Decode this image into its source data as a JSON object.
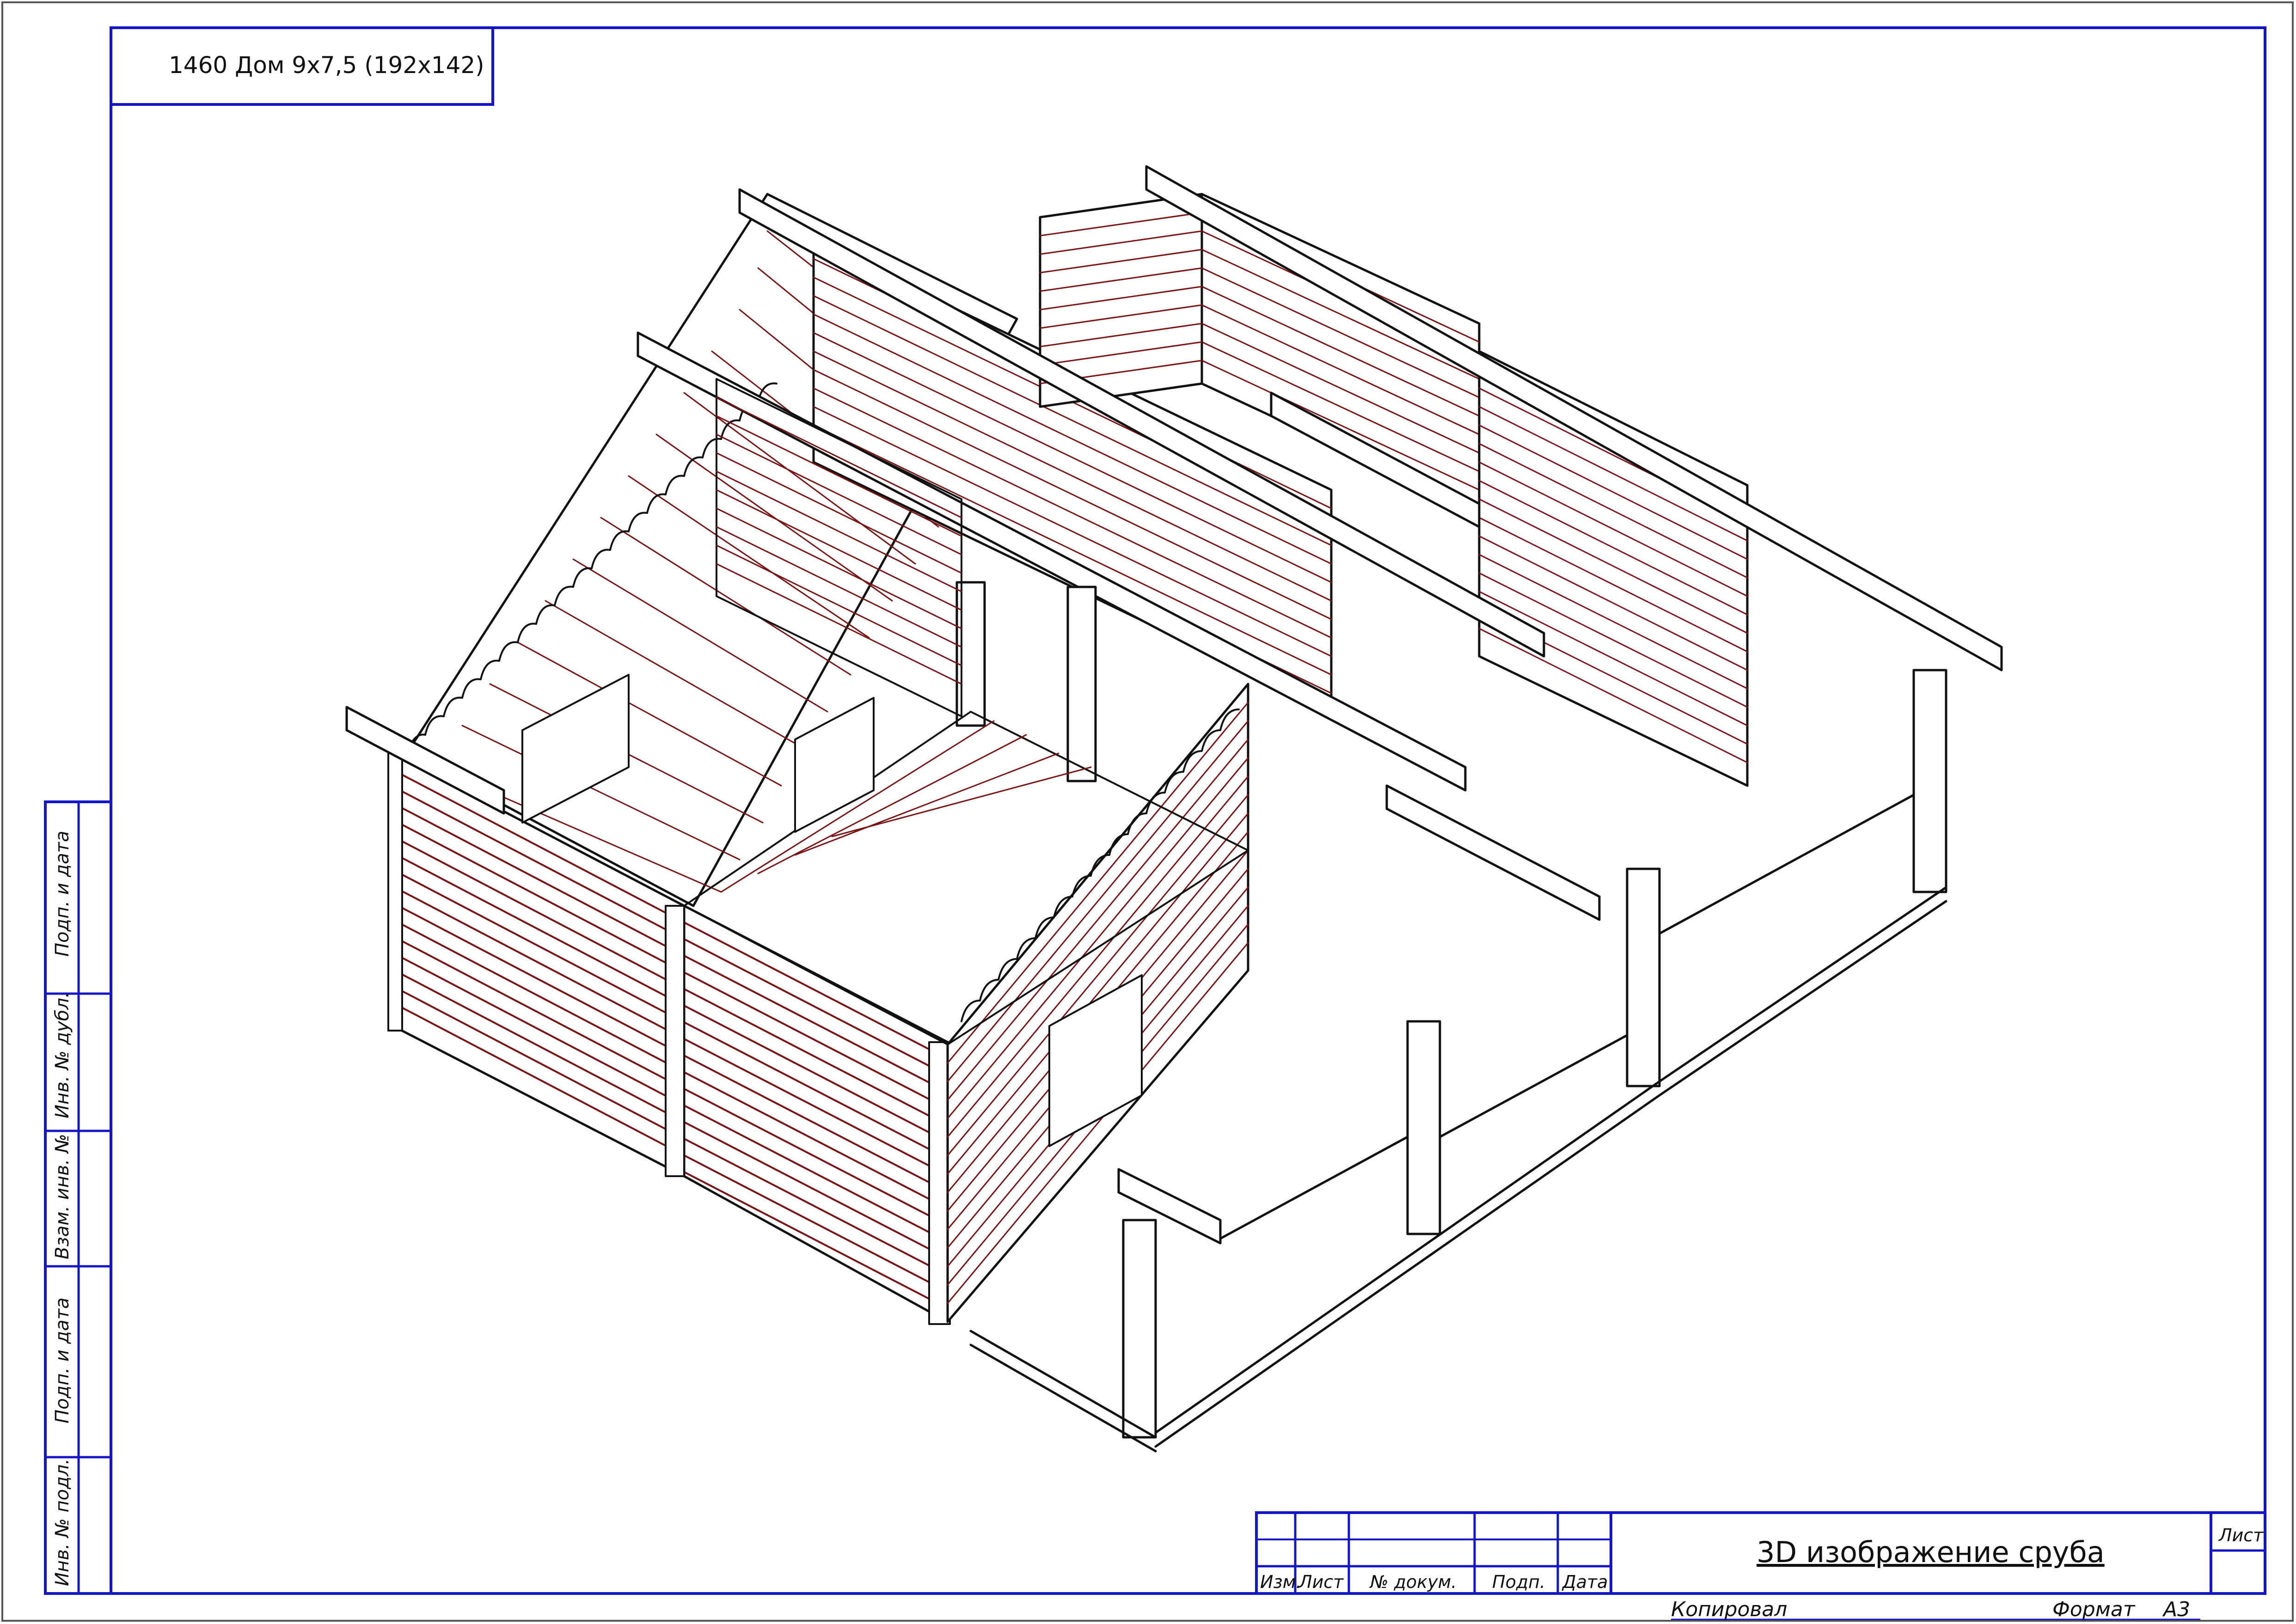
{
  "doc": {
    "project_label": "1460 Дом 9х7,5 (192х142)",
    "sheet_title": "3D изображение сруба"
  },
  "side_stamp": {
    "fields": [
      "Подп. и дата",
      "Инв. № дубл.",
      "Взам. инв. №",
      "Подп. и дата",
      "Инв. № подл."
    ]
  },
  "title_block": {
    "col_izm": "Изм.",
    "col_list": "Лист",
    "col_doc_no": "№ докум.",
    "col_sign": "Подп.",
    "col_date": "Дата",
    "sheet_label": "Лист"
  },
  "footer": {
    "copied_by": "Копировал",
    "format_label": "Формат",
    "format_value": "А3"
  },
  "colors": {
    "frame": "#1515c8",
    "outline": "#111111",
    "log_line": "#7a1414"
  }
}
